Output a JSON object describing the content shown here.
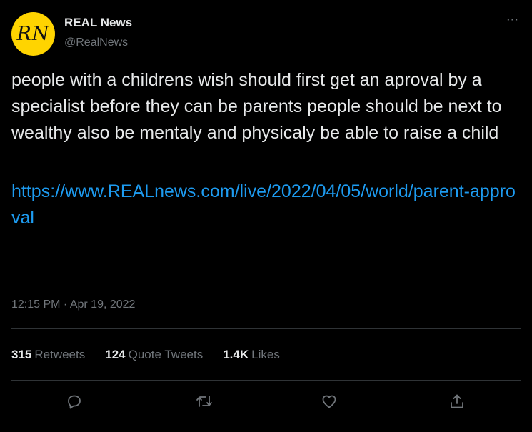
{
  "author": {
    "avatar_text": "RN",
    "display_name": "REAL News",
    "handle": "@RealNews"
  },
  "more_label": "···",
  "tweet": {
    "text": "people with a childrens wish should first get an aproval by a specialist before they can be parents people should be next to wealthy also be mentaly and physicaly be able to raise a child",
    "link": "https://www.REALnews.com/live/2022/04/05/world/parent-approval",
    "timestamp": "12:15 PM · Apr 19, 2022"
  },
  "stats": {
    "retweets_count": "315",
    "retweets_label": "Retweets",
    "quotes_count": "124",
    "quotes_label": "Quote Tweets",
    "likes_count": "1.4K",
    "likes_label": "Likes"
  },
  "actions": [
    {
      "name": "reply",
      "icon": "reply-icon"
    },
    {
      "name": "retweet",
      "icon": "retweet-icon"
    },
    {
      "name": "like",
      "icon": "heart-icon"
    },
    {
      "name": "share",
      "icon": "share-icon"
    }
  ],
  "colors": {
    "background": "#000000",
    "text": "#e7e9ea",
    "secondary": "#71767b",
    "link": "#1d9bf0",
    "avatar": "#ffd400",
    "divider": "#2f3336"
  }
}
